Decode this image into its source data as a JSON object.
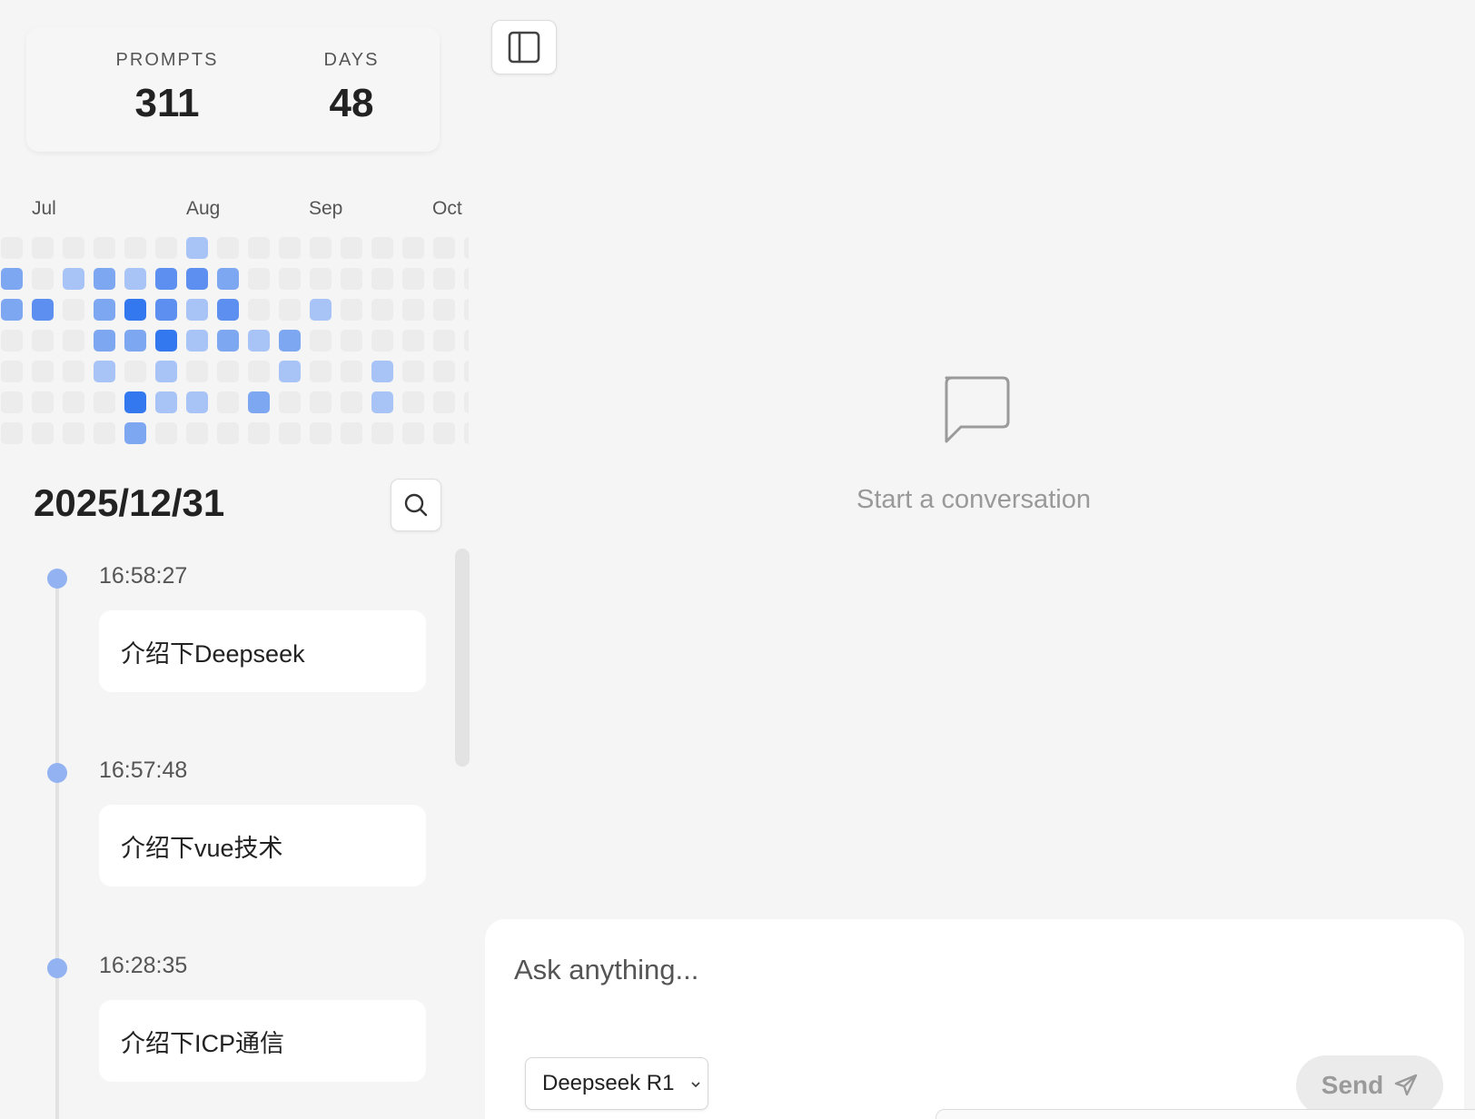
{
  "stats": {
    "prompts_label": "PROMPTS",
    "prompts_value": "311",
    "days_label": "DAYS",
    "days_value": "48"
  },
  "heatmap": {
    "months": [
      "Jul",
      "Aug",
      "Sep",
      "Oct"
    ],
    "levels": [
      [
        0,
        0,
        0,
        0,
        0,
        0,
        1,
        0,
        0,
        0,
        0,
        0,
        0,
        0,
        0,
        0
      ],
      [
        2,
        0,
        1,
        2,
        1,
        3,
        3,
        2,
        0,
        0,
        0,
        0,
        0,
        0,
        0,
        0
      ],
      [
        2,
        3,
        0,
        2,
        4,
        3,
        1,
        3,
        0,
        0,
        1,
        0,
        0,
        0,
        0,
        0
      ],
      [
        0,
        0,
        0,
        2,
        2,
        4,
        1,
        2,
        1,
        2,
        0,
        0,
        0,
        0,
        0,
        0
      ],
      [
        0,
        0,
        0,
        1,
        0,
        1,
        0,
        0,
        0,
        1,
        0,
        0,
        1,
        0,
        0,
        0
      ],
      [
        0,
        0,
        0,
        0,
        4,
        1,
        1,
        0,
        2,
        0,
        0,
        0,
        1,
        0,
        0,
        0
      ],
      [
        0,
        0,
        0,
        0,
        2,
        0,
        0,
        0,
        0,
        0,
        0,
        0,
        0,
        0,
        0,
        0
      ]
    ],
    "level_colors": [
      "#ececec",
      "#a8c4f6",
      "#7ea7f2",
      "#5c8ff0",
      "#3478f0"
    ]
  },
  "history": {
    "date": "2025/12/31",
    "entries": [
      {
        "time": "16:58:27",
        "text": "介绍下Deepseek"
      },
      {
        "time": "16:57:48",
        "text": "介绍下vue技术"
      },
      {
        "time": "16:28:35",
        "text": "介绍下ICP通信"
      }
    ]
  },
  "main": {
    "empty_state_text": "Start a conversation",
    "empty_state_icon": "chat-bubble-icon"
  },
  "composer": {
    "placeholder": "Ask anything...",
    "model": "Deepseek R1",
    "send_label": "Send"
  },
  "icons": {
    "sidebar_toggle": "sidebar-panel-icon",
    "search": "search-icon",
    "send": "paper-plane-icon"
  }
}
